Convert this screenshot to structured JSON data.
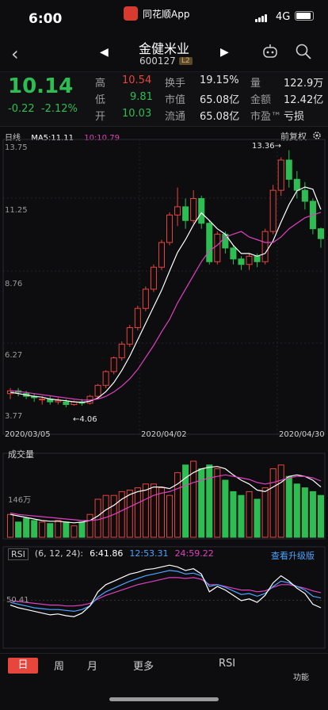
{
  "status": {
    "time": "6:00",
    "app": "同花顺App",
    "network": "4G"
  },
  "header": {
    "stock_name": "金健米业",
    "stock_code": "600127",
    "level_badge": "L2"
  },
  "quote": {
    "price": "10.14",
    "change": "-0.22",
    "change_pct": "-2.12%",
    "rows": [
      [
        {
          "label": "高",
          "value": "10.54",
          "tone": "red"
        },
        {
          "label": "换手",
          "value": "19.15%",
          "tone": "wht"
        },
        {
          "label": "量",
          "value": "122.9万",
          "tone": "wht"
        }
      ],
      [
        {
          "label": "低",
          "value": "9.81",
          "tone": "grn"
        },
        {
          "label": "市值",
          "value": "65.08亿",
          "tone": "wht"
        },
        {
          "label": "金额",
          "value": "12.42亿",
          "tone": "wht"
        }
      ],
      [
        {
          "label": "开",
          "value": "10.03",
          "tone": "grn"
        },
        {
          "label": "流通",
          "value": "65.08亿",
          "tone": "wht"
        },
        {
          "label": "市盈™",
          "value": "亏损",
          "tone": "wht"
        }
      ]
    ]
  },
  "kline": {
    "period": "日线",
    "ma5": "MA5:11.11",
    "ma10": "10:10.79",
    "fuquan": "前复权",
    "y_labels": [
      "13.75",
      "11.25",
      "8.76",
      "6.27",
      "3.77"
    ],
    "dates": [
      "2020/03/05",
      "2020/04/02",
      "2020/04/30"
    ],
    "high_mark": "13.36→",
    "low_mark": "←4.06",
    "candles": [
      [
        4.5,
        4.6,
        4.3,
        4.7
      ],
      [
        4.6,
        4.55,
        4.4,
        4.7
      ],
      [
        4.5,
        4.4,
        4.3,
        4.6
      ],
      [
        4.4,
        4.35,
        4.2,
        4.5
      ],
      [
        4.3,
        4.3,
        4.1,
        4.4
      ],
      [
        4.3,
        4.2,
        4.1,
        4.4
      ],
      [
        4.2,
        4.25,
        4.1,
        4.35
      ],
      [
        4.2,
        4.1,
        4.0,
        4.3
      ],
      [
        4.1,
        4.2,
        4.06,
        4.25
      ],
      [
        4.2,
        4.15,
        4.06,
        4.3
      ],
      [
        4.15,
        4.4,
        4.1,
        4.45
      ],
      [
        4.4,
        4.8,
        4.35,
        4.85
      ],
      [
        4.8,
        5.3,
        4.7,
        5.35
      ],
      [
        5.3,
        5.8,
        5.2,
        5.85
      ],
      [
        5.8,
        6.3,
        5.7,
        6.4
      ],
      [
        6.3,
        6.9,
        6.2,
        7.0
      ],
      [
        6.9,
        7.6,
        6.8,
        7.7
      ],
      [
        7.6,
        8.3,
        7.5,
        8.4
      ],
      [
        8.3,
        9.1,
        8.2,
        9.2
      ],
      [
        9.1,
        10.0,
        9.0,
        10.1
      ],
      [
        10.0,
        11.0,
        9.9,
        11.1
      ],
      [
        11.0,
        11.3,
        10.6,
        12.0
      ],
      [
        11.3,
        10.8,
        10.5,
        11.6
      ],
      [
        10.8,
        11.6,
        10.7,
        11.9
      ],
      [
        11.6,
        10.7,
        10.5,
        11.7
      ],
      [
        10.7,
        9.3,
        9.2,
        10.8
      ],
      [
        9.3,
        10.3,
        9.2,
        10.4
      ],
      [
        10.3,
        9.8,
        9.6,
        10.4
      ],
      [
        9.8,
        9.4,
        9.2,
        9.9
      ],
      [
        9.4,
        9.2,
        9.0,
        9.5
      ],
      [
        9.2,
        9.5,
        9.0,
        9.6
      ],
      [
        9.5,
        9.3,
        9.1,
        9.6
      ],
      [
        9.3,
        10.4,
        9.2,
        10.5
      ],
      [
        10.4,
        11.9,
        10.3,
        12.1
      ],
      [
        11.9,
        13.0,
        11.7,
        13.1
      ],
      [
        13.0,
        12.3,
        12.0,
        13.36
      ],
      [
        12.3,
        11.9,
        11.6,
        12.6
      ],
      [
        11.9,
        11.5,
        11.2,
        12.2
      ],
      [
        11.5,
        10.5,
        10.3,
        11.6
      ],
      [
        10.5,
        10.14,
        9.81,
        10.54
      ]
    ],
    "ma5_values": [
      4.55,
      4.5,
      4.45,
      4.4,
      4.37,
      4.3,
      4.27,
      4.24,
      4.2,
      4.18,
      4.22,
      4.34,
      4.57,
      4.9,
      5.34,
      5.86,
      6.46,
      7.06,
      7.66,
      8.26,
      8.96,
      9.64,
      10.1,
      10.64,
      11.08,
      10.8,
      10.5,
      10.3,
      9.9,
      9.6,
      9.6,
      9.5,
      9.6,
      10.06,
      10.74,
      11.38,
      11.88,
      12.02,
      11.94,
      11.2
    ],
    "ma10_values": [
      4.6,
      4.58,
      4.54,
      4.5,
      4.46,
      4.42,
      4.38,
      4.34,
      4.3,
      4.27,
      4.26,
      4.3,
      4.4,
      4.56,
      4.77,
      5.04,
      5.38,
      5.82,
      6.25,
      6.75,
      7.2,
      7.8,
      8.3,
      8.8,
      9.3,
      9.7,
      9.9,
      10.2,
      10.3,
      10.4,
      10.2,
      10.1,
      10.0,
      10.0,
      10.2,
      10.5,
      10.7,
      10.9,
      11.0,
      11.1
    ]
  },
  "volume": {
    "title": "成交量",
    "y_label": "146万",
    "bars": [
      0.3,
      0.2,
      0.25,
      0.22,
      0.2,
      0.18,
      0.22,
      0.2,
      0.15,
      0.2,
      0.3,
      0.5,
      0.55,
      0.55,
      0.6,
      0.62,
      0.65,
      0.7,
      0.7,
      0.65,
      0.55,
      0.85,
      0.95,
      1.0,
      0.9,
      0.95,
      0.9,
      0.75,
      0.6,
      0.55,
      0.6,
      0.5,
      0.65,
      0.9,
      0.95,
      0.8,
      0.7,
      0.65,
      0.6,
      0.55
    ],
    "ma_a": [
      0.3,
      0.28,
      0.26,
      0.24,
      0.22,
      0.21,
      0.21,
      0.2,
      0.19,
      0.2,
      0.22,
      0.28,
      0.36,
      0.42,
      0.5,
      0.56,
      0.6,
      0.62,
      0.66,
      0.66,
      0.64,
      0.7,
      0.78,
      0.85,
      0.9,
      0.92,
      0.93,
      0.9,
      0.82,
      0.75,
      0.7,
      0.62,
      0.6,
      0.66,
      0.72,
      0.8,
      0.82,
      0.8,
      0.75,
      0.66
    ],
    "ma_b": [
      0.32,
      0.3,
      0.29,
      0.28,
      0.27,
      0.26,
      0.25,
      0.24,
      0.23,
      0.22,
      0.22,
      0.23,
      0.26,
      0.3,
      0.35,
      0.4,
      0.45,
      0.5,
      0.55,
      0.58,
      0.6,
      0.64,
      0.68,
      0.72,
      0.75,
      0.78,
      0.8,
      0.82,
      0.8,
      0.78,
      0.76,
      0.72,
      0.7,
      0.72,
      0.75,
      0.78,
      0.8,
      0.8,
      0.78,
      0.74
    ]
  },
  "rsi": {
    "title": "RSI",
    "params": "(6, 12, 24):",
    "rsi6": "6:41.86",
    "rsi12": "12:53.31",
    "rsi24": "24:59.22",
    "upgrade_link": "查看升级版",
    "level_label": "50.41",
    "r6": [
      45,
      42,
      40,
      38,
      36,
      34,
      35,
      33,
      32,
      36,
      44,
      60,
      68,
      72,
      76,
      80,
      82,
      85,
      86,
      88,
      90,
      88,
      84,
      86,
      80,
      60,
      66,
      62,
      56,
      50,
      52,
      48,
      56,
      70,
      78,
      72,
      64,
      58,
      46,
      42
    ],
    "r12": [
      48,
      46,
      44,
      42,
      41,
      40,
      40,
      39,
      38,
      40,
      44,
      54,
      60,
      64,
      68,
      72,
      75,
      78,
      80,
      82,
      84,
      83,
      80,
      81,
      78,
      66,
      68,
      65,
      61,
      57,
      58,
      55,
      58,
      66,
      72,
      70,
      66,
      62,
      55,
      53
    ],
    "r24": [
      50,
      49,
      48,
      47,
      46,
      45,
      45,
      44,
      44,
      45,
      47,
      52,
      56,
      59,
      62,
      65,
      68,
      70,
      72,
      74,
      76,
      76,
      75,
      76,
      74,
      68,
      68,
      66,
      64,
      62,
      62,
      60,
      61,
      65,
      68,
      68,
      66,
      64,
      61,
      59
    ]
  },
  "colors": {
    "up": "#e8453c",
    "down": "#2ebd52",
    "ma5": "#ffffff",
    "ma10": "#e040c0",
    "rsi6": "#ffffff",
    "rsi12": "#4da3ff",
    "rsi24": "#e040c0"
  },
  "bottom": {
    "tabs": [
      "日",
      "周",
      "月",
      "更多",
      "RSI",
      "功能"
    ],
    "active": "日"
  }
}
